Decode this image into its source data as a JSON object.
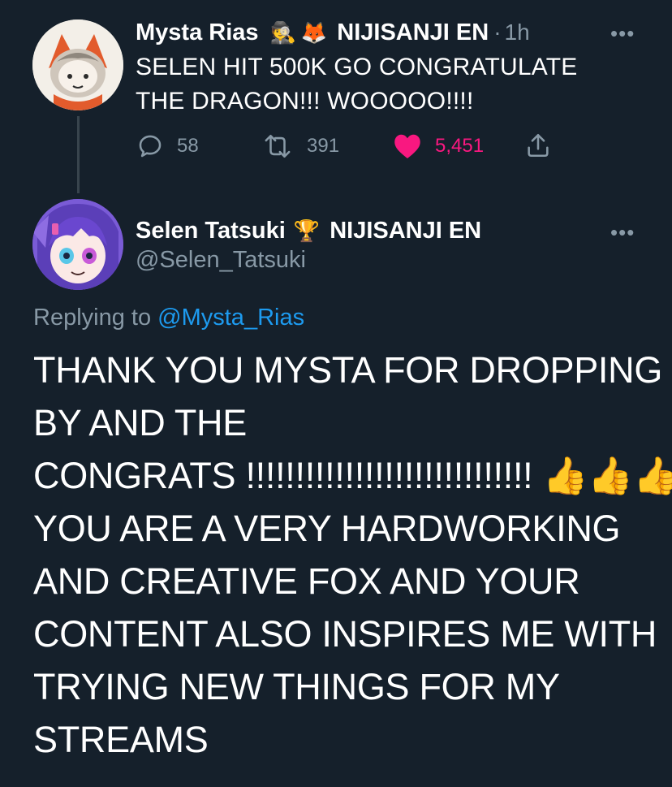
{
  "tweet1": {
    "name": "Mysta Rias",
    "badge_emojis": [
      "🕵️",
      "🦊"
    ],
    "affiliation": "NIJISANJI EN",
    "separator": "·",
    "time": "1h",
    "more": "•••",
    "text_line1": "SELEN HIT 500K GO CONGRATULATE",
    "text_line2": "THE DRAGON!!! WOOOOO!!!!",
    "replies": "58",
    "retweets": "391",
    "likes": "5,451",
    "liked": true
  },
  "tweet2": {
    "name": "Selen Tatsuki",
    "badge_emoji": "🏆",
    "affiliation": "NIJISANJI EN",
    "handle": "@Selen_Tatsuki",
    "more": "•••",
    "replying_prefix": "Replying to",
    "replying_handle": "@Mysta_Rias",
    "lines": [
      "THANK YOU MYSTA FOR DROPPING",
      "BY AND THE",
      "CONGRATS !!!!!!!!!!!!!!!!!!!!!!!!!!!!! 👍👍👍",
      "YOU ARE A VERY HARDWORKING",
      "AND CREATIVE FOX AND YOUR",
      "CONTENT ALSO INSPIRES ME WITH",
      "TRYING NEW THINGS FOR MY",
      "STREAMS"
    ]
  },
  "colors": {
    "background": "#15202b",
    "muted": "#8899a6",
    "link": "#1d9bf0",
    "like": "#f91880"
  }
}
